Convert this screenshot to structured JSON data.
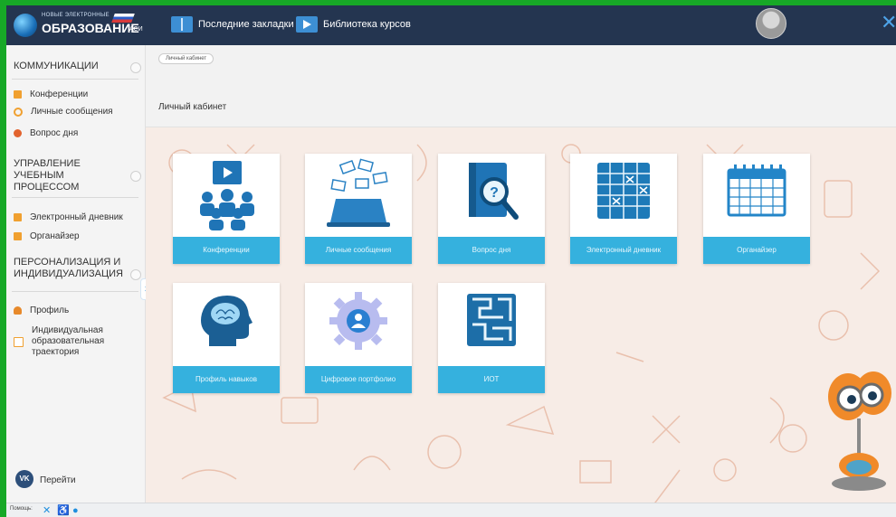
{
  "topbar": {
    "logo_small": "НОВЫЕ ЭЛЕКТРОННЫЕ",
    "logo_big": "ОБРАЗОВАНИЕ",
    "logo_tag": "АСИ",
    "nav": [
      {
        "label": "Последние закладки",
        "icon": "book-icon"
      },
      {
        "label": "Библиотека курсов",
        "icon": "video-play-icon"
      }
    ]
  },
  "sidebar": {
    "sections": [
      {
        "title": "КОММУНИКАЦИИ",
        "items": [
          {
            "label": "Конференции",
            "icon": "conference-icon",
            "color": "#f0a030"
          },
          {
            "label": "Личные сообщения",
            "icon": "message-icon",
            "color": "#f0a030"
          },
          {
            "label": "Вопрос дня",
            "icon": "magnifier-icon",
            "color": "#e2632e"
          }
        ]
      },
      {
        "title": "УПРАВЛЕНИЕ УЧЕБНЫМ ПРОЦЕССОМ",
        "items": [
          {
            "label": "Электронный дневник",
            "icon": "diary-icon",
            "color": "#f0a030"
          },
          {
            "label": "Органайзер",
            "icon": "calendar-icon",
            "color": "#f0a030"
          }
        ]
      },
      {
        "title": "ПЕРСОНАЛИЗАЦИЯ И ИНДИВИДУАЛИЗАЦИЯ",
        "items": [
          {
            "label": "Профиль",
            "icon": "person-icon",
            "color": "#e7892b"
          },
          {
            "label": "Индивидуальная образовательная траектория",
            "icon": "path-icon",
            "color": "#f0a030"
          }
        ]
      }
    ],
    "footer_link": "Перейти",
    "vk_label": "VK"
  },
  "content": {
    "breadcrumb": "Личный кабинет",
    "title": "Личный кабинет",
    "tiles": [
      {
        "label": "Конференции",
        "icon": "conference-tile-icon"
      },
      {
        "label": "Личные сообщения",
        "icon": "messages-tile-icon"
      },
      {
        "label": "Вопрос дня",
        "icon": "question-tile-icon"
      },
      {
        "label": "Электронный дневник",
        "icon": "diary-tile-icon"
      },
      {
        "label": "Органайзер",
        "icon": "calendar-tile-icon"
      },
      {
        "label": "Профиль навыков",
        "icon": "brain-tile-icon"
      },
      {
        "label": "Цифровое портфолио",
        "icon": "portfolio-gear-icon"
      },
      {
        "label": "ИОТ",
        "icon": "maze-tile-icon"
      }
    ]
  },
  "bottombar": {
    "help_label": "Помощь:"
  },
  "colors": {
    "topbar": "#243550",
    "tile_label": "#35b1de",
    "accent": "#1a8ddc",
    "frame": "#17a827"
  }
}
